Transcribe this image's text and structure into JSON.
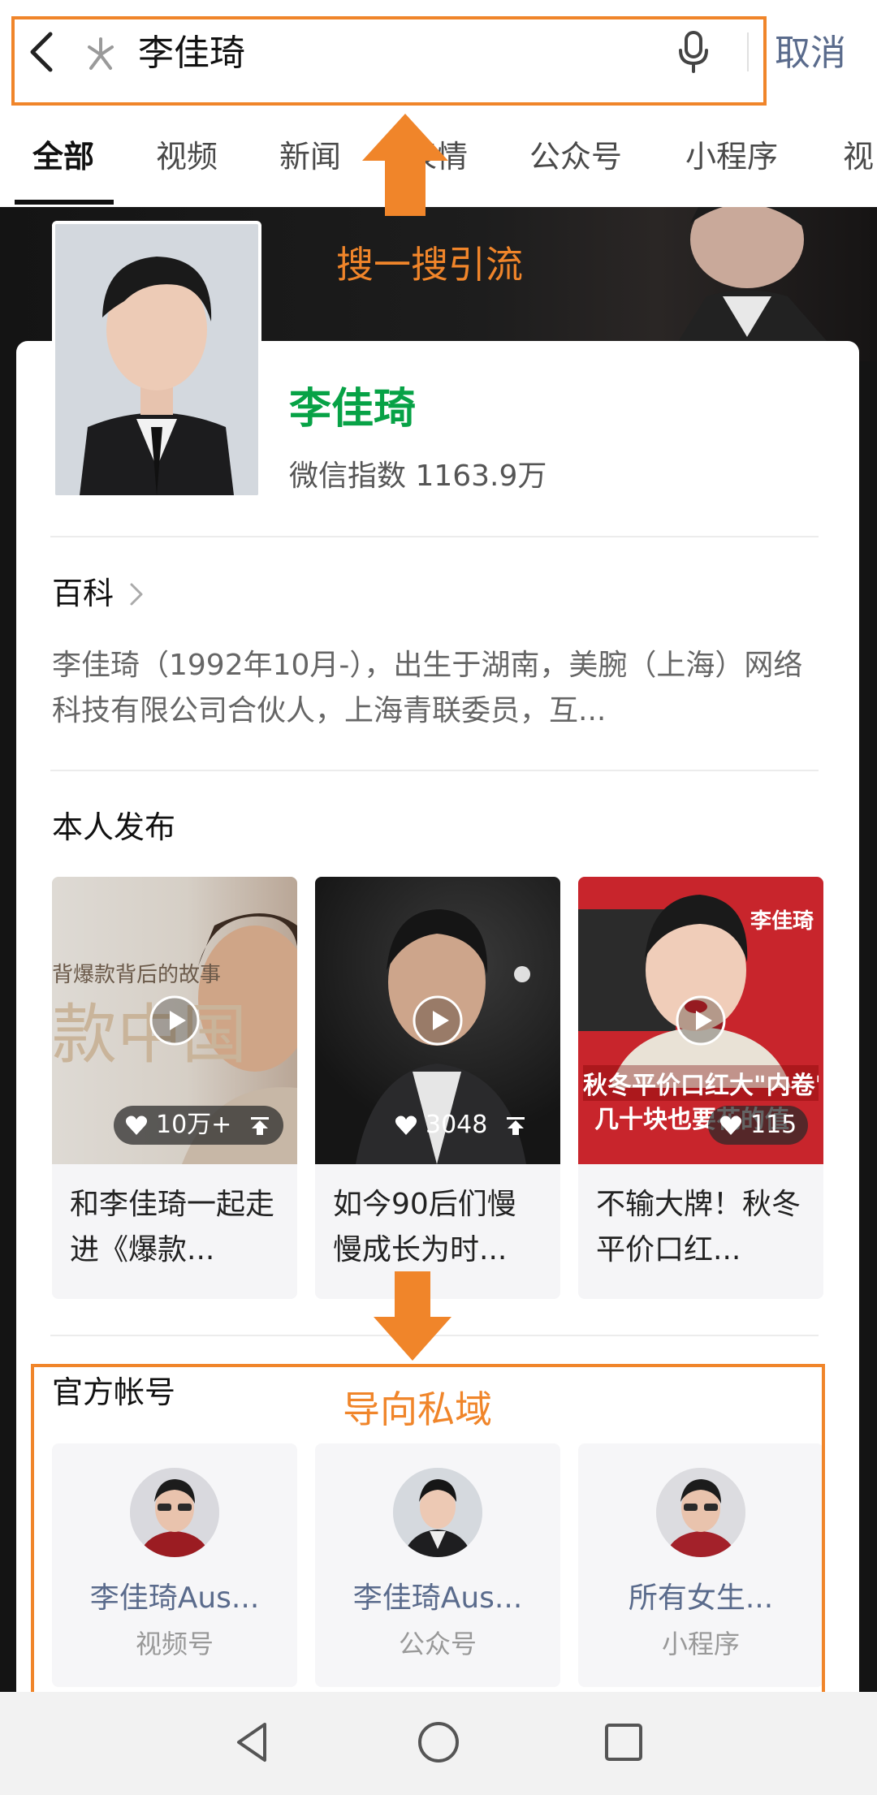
{
  "search": {
    "query": "李佳琦",
    "cancel_label": "取消"
  },
  "tabs": [
    {
      "label": "全部",
      "active": true
    },
    {
      "label": "视频"
    },
    {
      "label": "新闻"
    },
    {
      "label": "表情"
    },
    {
      "label": "公众号"
    },
    {
      "label": "小程序"
    },
    {
      "label": "视"
    }
  ],
  "annotations": {
    "top": "搜一搜引流",
    "bottom": "导向私域"
  },
  "profile": {
    "name": "李佳琦",
    "wechat_index": "微信指数 1163.9万"
  },
  "encyclopedia": {
    "title": "百科",
    "text": "李佳琦（1992年10月-），出生于湖南，美腕（上海）网络科技有限公司合伙人，上海青联委员，互..."
  },
  "personal_posts": {
    "title": "本人发布",
    "videos": [
      {
        "likes": "10万+",
        "pinned": true,
        "title": "和李佳琦一起走进《爆款...",
        "overlay_text": "款中国"
      },
      {
        "likes": "3048",
        "pinned": true,
        "title": "如今90后们慢慢成长为时..."
      },
      {
        "likes": "115",
        "pinned": false,
        "title": "不输大牌！秋冬平价口红...",
        "overlay_text": "秋冬平价口红大\"内卷\"",
        "overlay_text2": "几十块也要花的值",
        "badge": "李佳琦"
      }
    ]
  },
  "official_accounts": {
    "title": "官方帐号",
    "accounts": [
      {
        "name": "李佳琦Aus...",
        "type": "视频号"
      },
      {
        "name": "李佳琦Aus...",
        "type": "公众号"
      },
      {
        "name": "所有女生...",
        "type": "小程序"
      }
    ]
  },
  "colors": {
    "annotation": "#f0852a",
    "name_green": "#07a246",
    "link_blue": "#5a6b8c"
  },
  "icons": [
    "back-icon",
    "wechat-search-icon",
    "mic-icon",
    "chevron-right-icon",
    "play-icon",
    "heart-icon",
    "pin-icon",
    "nav-back-icon",
    "nav-home-icon",
    "nav-recent-icon"
  ]
}
